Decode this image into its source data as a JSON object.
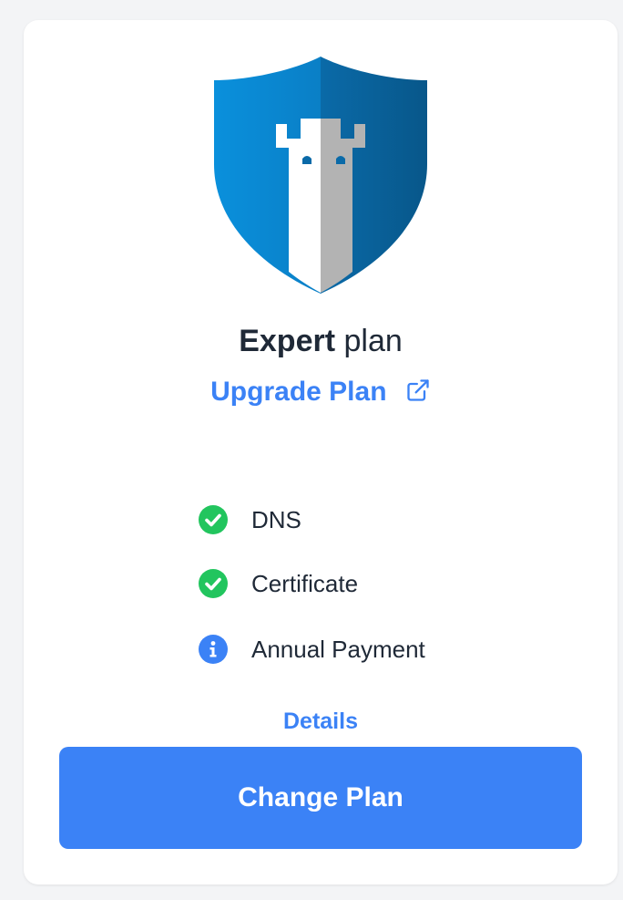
{
  "plan": {
    "name_strong": "Expert",
    "name_suffix": "plan",
    "upgrade_label": "Upgrade Plan",
    "upgrade_icon": "external-link-icon"
  },
  "features": [
    {
      "label": "DNS",
      "icon": "check-circle-icon",
      "status": "included",
      "color": "#22c55e"
    },
    {
      "label": "Certificate",
      "icon": "check-circle-icon",
      "status": "included",
      "color": "#22c55e"
    },
    {
      "label": "Annual Payment",
      "icon": "info-circle-icon",
      "status": "info",
      "color": "#3b82f6"
    }
  ],
  "details_label": "Details",
  "change_plan_label": "Change Plan",
  "colors": {
    "accent": "#3b82f6",
    "success": "#22c55e",
    "shield_light": "#0a8fd8",
    "shield_dark": "#0a5f96",
    "tower_light": "#ffffff",
    "tower_shadow": "#b3b3b3"
  }
}
